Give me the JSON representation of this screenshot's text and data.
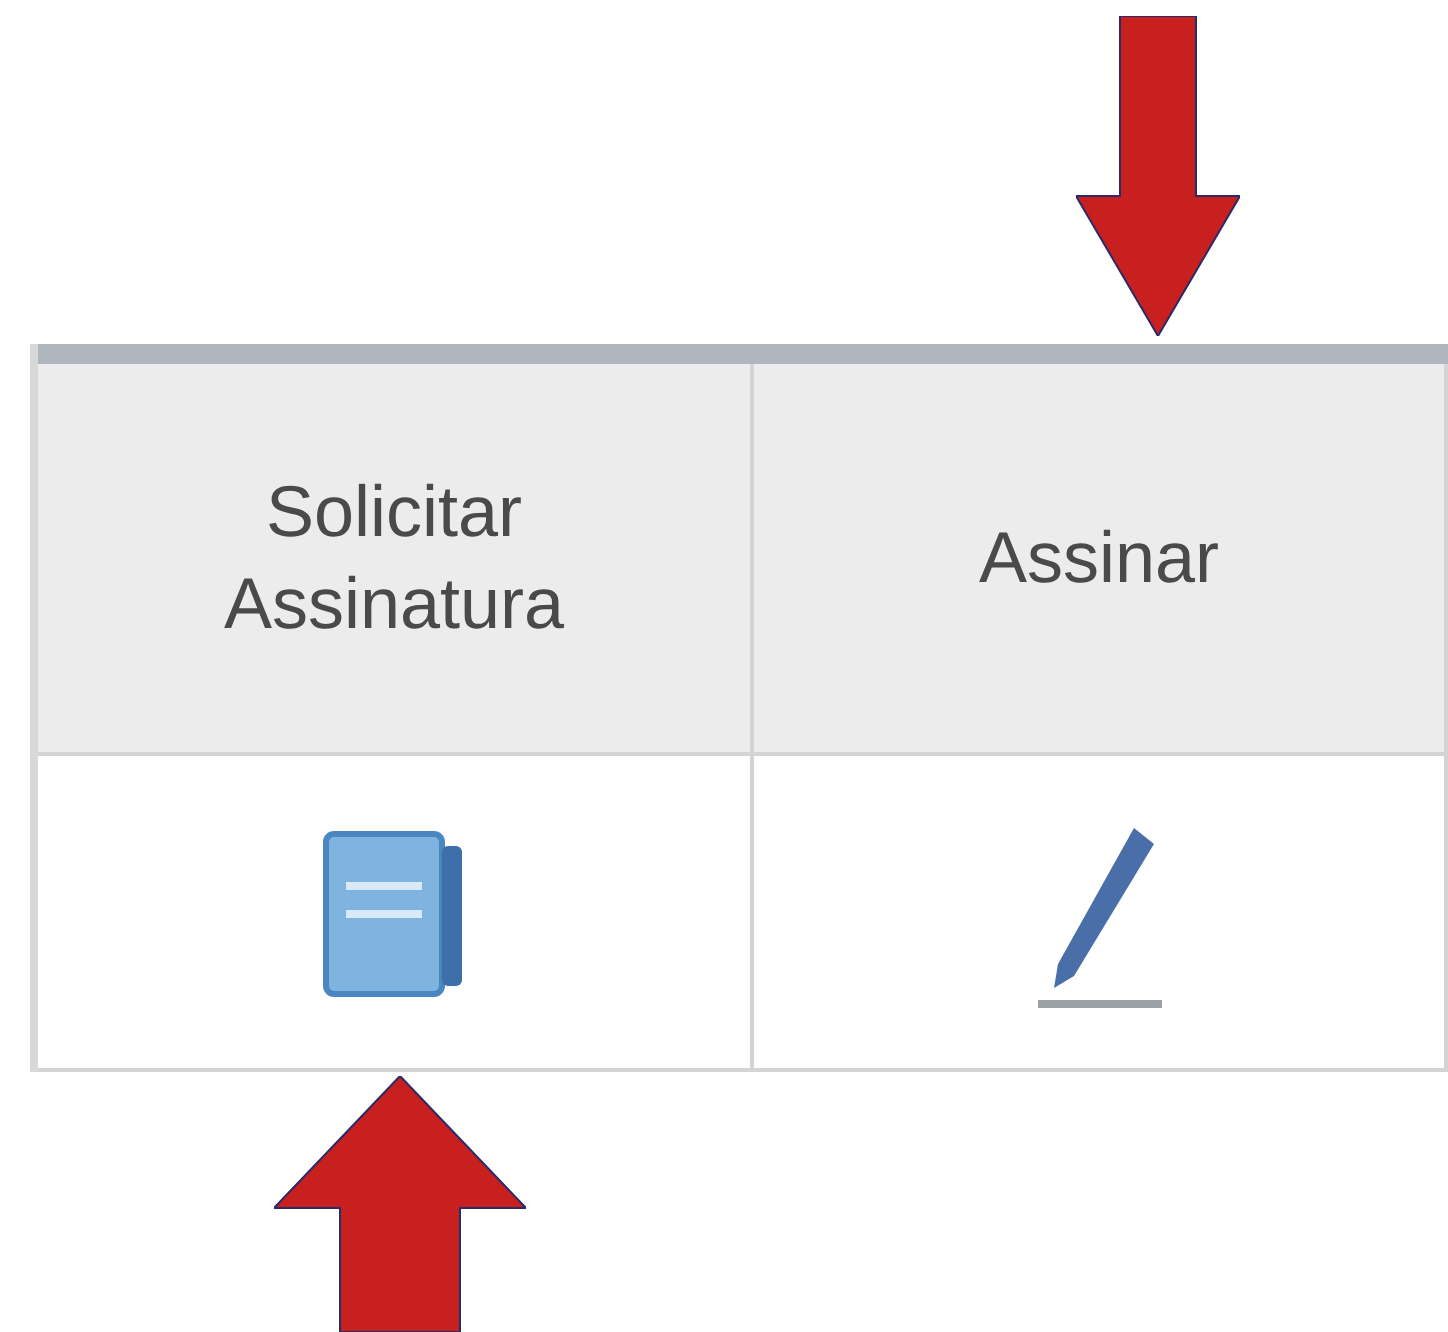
{
  "table": {
    "columns": [
      {
        "label": "Solicitar Assinatura"
      },
      {
        "label": "Assinar"
      }
    ]
  }
}
